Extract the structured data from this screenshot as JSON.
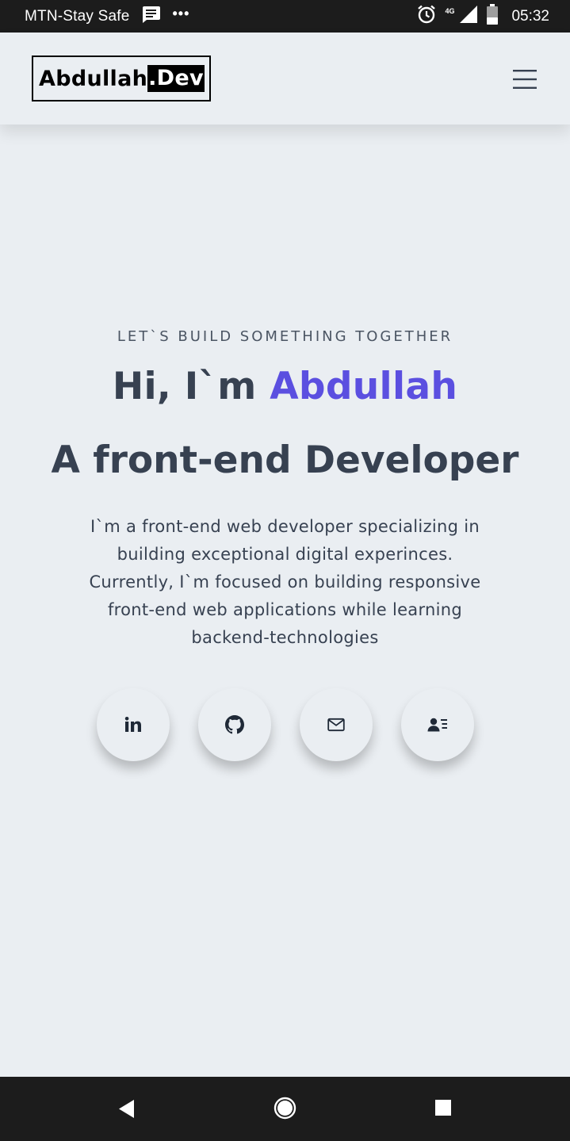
{
  "status_bar": {
    "carrier": "MTN-Stay Safe",
    "network_type": "4G",
    "time": "05:32"
  },
  "header": {
    "logo_name": "Abdullah",
    "logo_ext": ".Dev"
  },
  "hero": {
    "tagline": "LET`S BUILD SOMETHING TOGETHER",
    "greeting": "Hi, I`m ",
    "name": "Abdullah",
    "role": "A front-end Developer",
    "bio": "I`m a front-end web developer specializing in building exceptional digital experinces. Currently, I`m focused on building responsive front-end web applications while learning backend-technologies"
  },
  "socials": [
    {
      "icon": "linkedin-icon"
    },
    {
      "icon": "github-icon"
    },
    {
      "icon": "mail-icon"
    },
    {
      "icon": "contact-card-icon"
    }
  ],
  "colors": {
    "background": "#eaeef2",
    "text": "#374151",
    "accent": "#5b4fe0",
    "system_bar": "#1c1c1c"
  }
}
